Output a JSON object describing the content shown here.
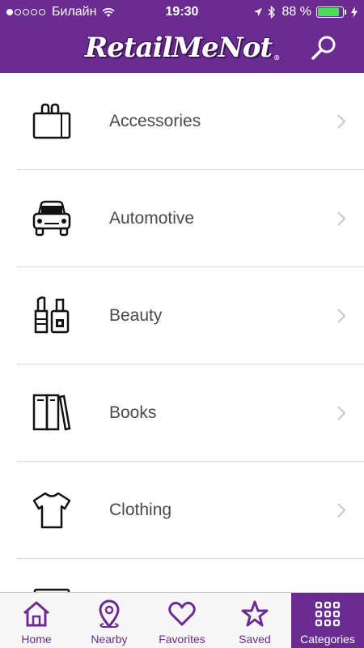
{
  "status_bar": {
    "carrier": "Билайн",
    "time": "19:30",
    "battery_percent": "88 %",
    "battery_level": 0.88,
    "signal_bars_filled": 1,
    "signal_bars_total": 5
  },
  "nav": {
    "logo_text": "RetailMeNot",
    "logo_mark": "®",
    "search_icon": "search-icon"
  },
  "categories": [
    {
      "label": "Accessories",
      "icon": "shopping-bag-icon"
    },
    {
      "label": "Automotive",
      "icon": "car-icon"
    },
    {
      "label": "Beauty",
      "icon": "cosmetics-icon"
    },
    {
      "label": "Books",
      "icon": "books-icon"
    },
    {
      "label": "Clothing",
      "icon": "tshirt-icon"
    },
    {
      "label": "",
      "icon": "partial-icon"
    }
  ],
  "tabs": [
    {
      "label": "Home",
      "icon": "home-icon",
      "active": false
    },
    {
      "label": "Nearby",
      "icon": "location-pin-icon",
      "active": false
    },
    {
      "label": "Favorites",
      "icon": "heart-icon",
      "active": false
    },
    {
      "label": "Saved",
      "icon": "star-icon",
      "active": false
    },
    {
      "label": "Categories",
      "icon": "grid-icon",
      "active": true
    }
  ],
  "colors": {
    "brand_purple": "#6a2c91",
    "battery_green": "#4cd964",
    "label_gray": "#4a4a4a",
    "chevron_gray": "#c7c7cc"
  }
}
